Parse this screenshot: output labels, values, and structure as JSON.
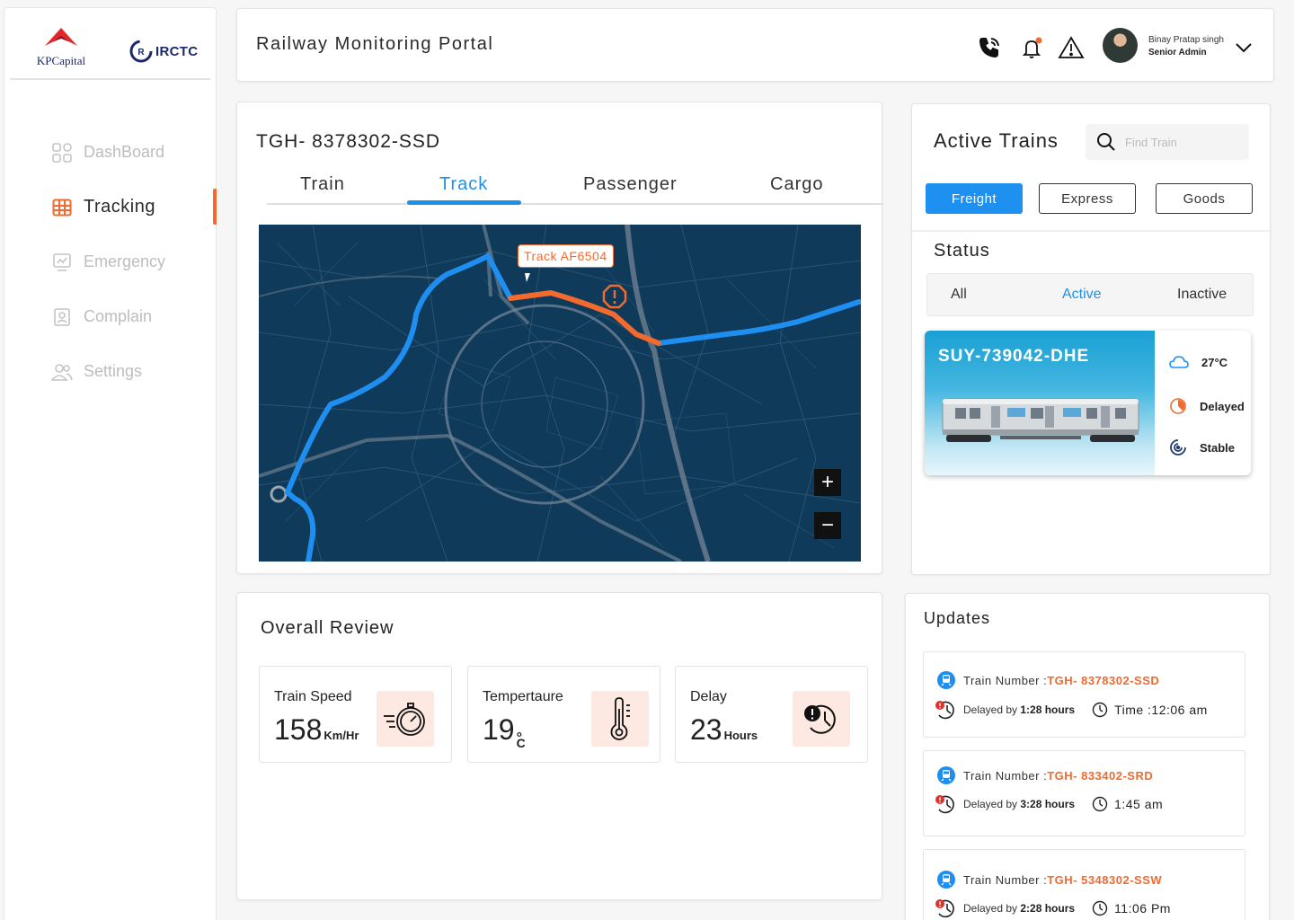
{
  "brand": {
    "kp_name": "KPCapital",
    "irctc_name": "IRCTC"
  },
  "colors": {
    "accent_orange": "#f26a2e",
    "accent_blue": "#1e90e8",
    "map_bg": "#0f3a5a",
    "route_blue": "#1e8ff0"
  },
  "sidebar": {
    "items": [
      {
        "label": "DashBoard",
        "icon": "grid-icon",
        "active": false
      },
      {
        "label": "Tracking",
        "icon": "tracking-icon",
        "active": true
      },
      {
        "label": "Emergency",
        "icon": "emergency-icon",
        "active": false
      },
      {
        "label": "Complain",
        "icon": "complain-icon",
        "active": false
      },
      {
        "label": "Settings",
        "icon": "users-icon",
        "active": false
      }
    ]
  },
  "header": {
    "title": "Railway Monitoring Portal",
    "user_name": "Binay Pratap singh",
    "user_role": "Senior Admin"
  },
  "tracking": {
    "train_id": "TGH- 8378302-SSD",
    "tabs": [
      "Train",
      "Track",
      "Passenger",
      "Cargo"
    ],
    "active_tab": "Track",
    "map_badge": "Track AF6504",
    "zoom_in": "+",
    "zoom_out": "−"
  },
  "active_trains": {
    "title": "Active Trains",
    "search_placeholder": "Find Train",
    "types": [
      "Freight",
      "Express",
      "Goods"
    ],
    "active_type": "Freight",
    "status_title": "Status",
    "status_options": [
      "All",
      "Active",
      "Inactive"
    ],
    "active_status": "Active",
    "card": {
      "name": "SUY-739042-DHE",
      "temperature": "27°C",
      "state": "Delayed",
      "condition": "Stable"
    }
  },
  "review": {
    "title": "Overall Review",
    "metrics": [
      {
        "label": "Train Speed",
        "value": "158",
        "unit": "Km/Hr",
        "icon": "speedometer-icon"
      },
      {
        "label": "Tempertaure",
        "value": "19",
        "unit_top": "°",
        "unit": "C",
        "icon": "thermometer-icon"
      },
      {
        "label": "Delay",
        "value": "23",
        "unit": "Hours",
        "icon": "delay-clock-icon"
      }
    ]
  },
  "updates": {
    "title": "Updates",
    "items": [
      {
        "label": "Train Number :",
        "number": "TGH- 8378302-SSD",
        "delay_prefix": "Delayed by ",
        "delay": "1:28 hours",
        "time": "Time :12:06 am"
      },
      {
        "label": "Train Number :",
        "number": "TGH- 833402-SRD",
        "delay_prefix": "Delayed by ",
        "delay": "3:28 hours",
        "time": "1:45 am"
      },
      {
        "label": "Train Number :",
        "number": "TGH- 5348302-SSW",
        "delay_prefix": "Delayed by ",
        "delay": "2:28 hours",
        "time": "11:06 Pm"
      }
    ]
  }
}
